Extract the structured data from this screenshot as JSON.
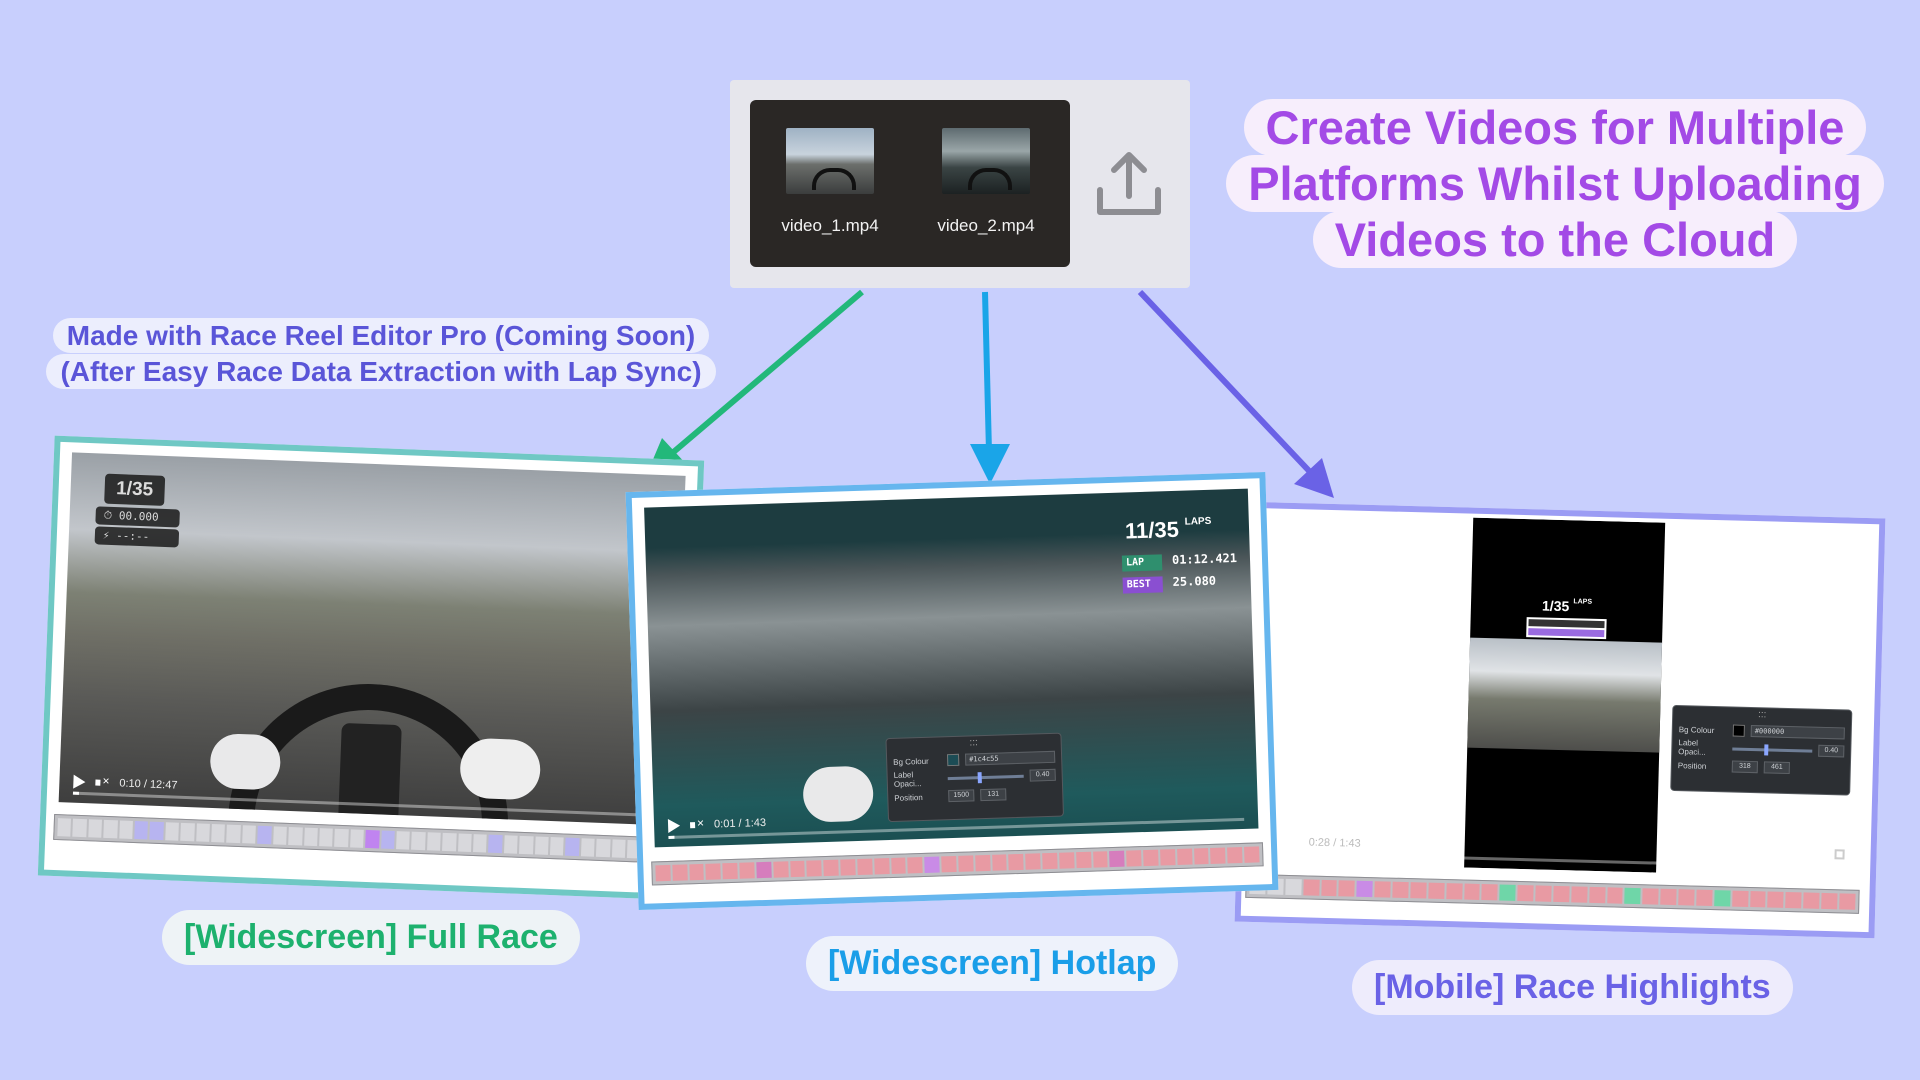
{
  "upload": {
    "files": [
      {
        "name": "video_1.mp4",
        "thumb": "kart-track-thumbnail"
      },
      {
        "name": "video_2.mp4",
        "thumb": "indoor-kart-thumbnail"
      }
    ],
    "icon": "upload-icon"
  },
  "headline": {
    "line1": "Create Videos for Multiple",
    "line2": "Platforms Whilst Uploading",
    "line3": "Videos to the Cloud",
    "color": "#a34ae6"
  },
  "made_with": {
    "line1": "Made with Race Reel Editor Pro (Coming Soon)",
    "line2": "(After Easy Race Data Extraction with Lap Sync)"
  },
  "arrows": {
    "colors": [
      "#22b87a",
      "#1aa5e8",
      "#6a62e6"
    ]
  },
  "cards": {
    "full_race": {
      "caption": "[Widescreen] Full Race",
      "caption_color": "#1db16e",
      "border_color": "#6fc8c4",
      "lap_count": "1/35",
      "timer": "00.000",
      "lap_delta": "--:--",
      "time": "0:10 / 12:47",
      "progress": 0.01,
      "timeline_colors": [
        "#d8d8dc",
        "#d8d8dc",
        "#d8d8dc",
        "#d8d8dc",
        "#d8d8dc",
        "#b7b4f0",
        "#b7b4f0",
        "#d8d8dc",
        "#d8d8dc",
        "#d8d8dc",
        "#d8d8dc",
        "#d8d8dc",
        "#d8d8dc",
        "#b7b4f0",
        "#d8d8dc",
        "#d8d8dc",
        "#d8d8dc",
        "#d8d8dc",
        "#d8d8dc",
        "#d8d8dc",
        "#c084f0",
        "#b7b4f0",
        "#d8d8dc",
        "#d8d8dc",
        "#d8d8dc",
        "#d8d8dc",
        "#d8d8dc",
        "#d8d8dc",
        "#b7b4f0",
        "#d8d8dc",
        "#d8d8dc",
        "#d8d8dc",
        "#d8d8dc",
        "#b7b4f0",
        "#d8d8dc",
        "#d8d8dc",
        "#d8d8dc",
        "#d8d8dc",
        "#d8d8dc",
        "#d8d8dc"
      ]
    },
    "hotlap": {
      "caption": "[Widescreen] Hotlap",
      "caption_color": "#1a9ee8",
      "border_color": "#66b6ee",
      "lap_count": "11/35",
      "laps_label": "LAPS",
      "lap_label": "LAP",
      "lap_time": "01:12.421",
      "best_label": "BEST",
      "best_time": "25.080",
      "time": "0:01 / 1:43",
      "progress": 0.01,
      "panel": {
        "handle": ":::",
        "bg_label": "Bg Colour",
        "bg_value": "#1c4c55",
        "opacity_label": "Label Opaci...",
        "opacity_value": "0.40",
        "position_label": "Position",
        "pos_x": "1500",
        "pos_y": "131"
      },
      "timeline_colors": [
        "#e89aa3",
        "#e89aa3",
        "#e89aa3",
        "#e89aa3",
        "#e89aa3",
        "#e89aa3",
        "#d67dbd",
        "#e89aa3",
        "#e89aa3",
        "#e89aa3",
        "#e89aa3",
        "#e89aa3",
        "#e89aa3",
        "#e89aa3",
        "#e89aa3",
        "#e89aa3",
        "#c98be6",
        "#e89aa3",
        "#e89aa3",
        "#e89aa3",
        "#e89aa3",
        "#e89aa3",
        "#e89aa3",
        "#e89aa3",
        "#e89aa3",
        "#e89aa3",
        "#e89aa3",
        "#d67dbd",
        "#e89aa3",
        "#e89aa3",
        "#e89aa3",
        "#e89aa3",
        "#e89aa3",
        "#e89aa3",
        "#e89aa3",
        "#e89aa3"
      ]
    },
    "highlights": {
      "caption": "[Mobile] Race Highlights",
      "caption_color": "#6a62e6",
      "border_color": "#9b9cf4",
      "lap_count": "1/35",
      "laps_label": "LAPS",
      "time": "0:28 / 1:43",
      "progress": 0.02,
      "panel": {
        "handle": ":::",
        "bg_label": "Bg Colour",
        "bg_value": "#000000",
        "opacity_label": "Label Opaci...",
        "opacity_value": "0.40",
        "position_label": "Position",
        "pos_x": "318",
        "pos_y": "461"
      },
      "timeline_colors": [
        "#d8d8dc",
        "#d8d8dc",
        "#d8d8dc",
        "#e89aa3",
        "#e89aa3",
        "#e89aa3",
        "#c98be6",
        "#e89aa3",
        "#e89aa3",
        "#e89aa3",
        "#e89aa3",
        "#e89aa3",
        "#e89aa3",
        "#e89aa3",
        "#6fd6a8",
        "#e89aa3",
        "#e89aa3",
        "#e89aa3",
        "#e89aa3",
        "#e89aa3",
        "#e89aa3",
        "#6fd6a8",
        "#e89aa3",
        "#e89aa3",
        "#e89aa3",
        "#e89aa3",
        "#6fd6a8",
        "#e89aa3",
        "#e89aa3",
        "#e89aa3",
        "#e89aa3",
        "#e89aa3",
        "#e89aa3",
        "#e89aa3"
      ]
    }
  }
}
